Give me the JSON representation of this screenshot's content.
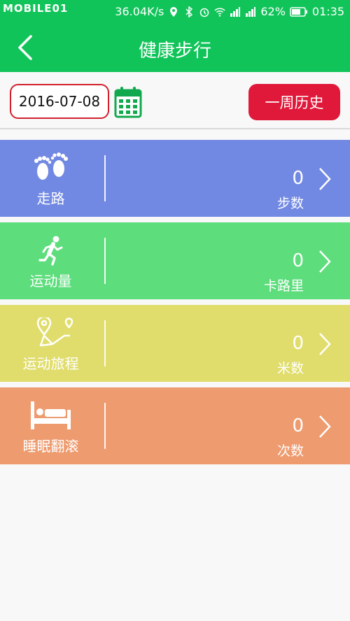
{
  "status_bar": {
    "carrier_logo": "MOBILE01",
    "speed": "36.04K/s",
    "battery": "62%",
    "time": "01:35"
  },
  "header": {
    "title": "健康步行",
    "back_icon": "chevron-left-icon"
  },
  "date_bar": {
    "date": "2016-07-08",
    "calendar_icon": "calendar-icon",
    "history_label": "一周历史"
  },
  "cards": [
    {
      "label": "走路",
      "value": "0",
      "unit": "步数",
      "icon": "footprints-icon",
      "color": "#7289e3"
    },
    {
      "label": "运动量",
      "value": "0",
      "unit": "卡路里",
      "icon": "runner-icon",
      "color": "#5ddd7c"
    },
    {
      "label": "运动旅程",
      "value": "0",
      "unit": "米数",
      "icon": "route-pin-icon",
      "color": "#e0dd6c"
    },
    {
      "label": "睡眠翻滚",
      "value": "0",
      "unit": "次数",
      "icon": "bed-icon",
      "color": "#ee9b6f"
    }
  ],
  "colors": {
    "primary_green": "#11c45a",
    "accent_red": "#e0183a"
  }
}
